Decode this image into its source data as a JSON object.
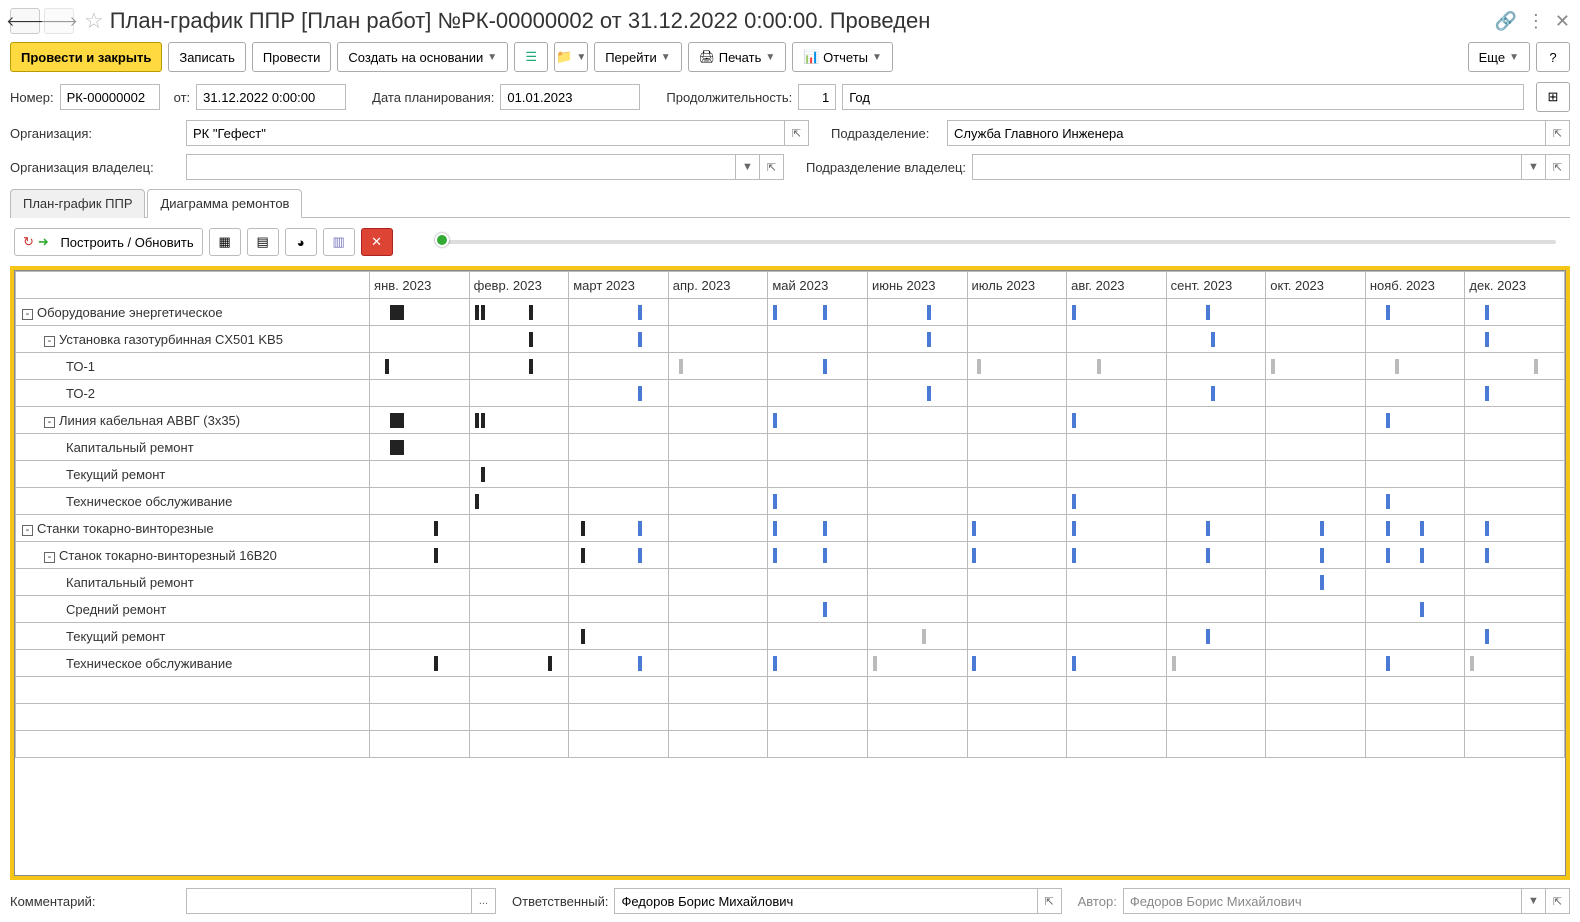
{
  "header": {
    "title": "План-график ППР [План работ] №РК-00000002 от 31.12.2022 0:00:00. Проведен"
  },
  "toolbar": {
    "post_close": "Провести и закрыть",
    "save": "Записать",
    "post": "Провести",
    "create_based": "Создать на основании",
    "goto": "Перейти",
    "print": "Печать",
    "reports": "Отчеты",
    "more": "Еще"
  },
  "form": {
    "number_lbl": "Номер:",
    "number_val": "РК-00000002",
    "from_lbl": "от:",
    "date_val": "31.12.2022 0:00:00",
    "plan_date_lbl": "Дата планирования:",
    "plan_date_val": "01.01.2023",
    "duration_lbl": "Продолжительность:",
    "duration_val": "1",
    "duration_unit": "Год",
    "org_lbl": "Организация:",
    "org_val": "РК \"Гефест\"",
    "dept_lbl": "Подразделение:",
    "dept_val": "Служба Главного Инженера",
    "org_owner_lbl": "Организация владелец:",
    "org_owner_val": "",
    "dept_owner_lbl": "Подразделение владелец:",
    "dept_owner_val": ""
  },
  "tabs": {
    "tab1": "План-график ППР",
    "tab2": "Диаграмма ремонтов"
  },
  "subtoolbar": {
    "rebuild": "Построить / Обновить"
  },
  "gantt": {
    "months": [
      "янв. 2023",
      "февр. 2023",
      "март 2023",
      "апр. 2023",
      "май 2023",
      "июнь 2023",
      "июль 2023",
      "авг. 2023",
      "сент. 2023",
      "окт. 2023",
      "нояб. 2023",
      "дек. 2023"
    ],
    "rows": [
      {
        "name": "Оборудование энергетическое",
        "indent": 0,
        "toggle": true,
        "bars": [
          {
            "m": 0,
            "cls": "black wide",
            "l": 20
          },
          {
            "m": 1,
            "cls": "black thin",
            "l": 5
          },
          {
            "m": 1,
            "cls": "black thin",
            "l": 12
          },
          {
            "m": 1,
            "cls": "black thin",
            "l": 60
          },
          {
            "m": 2,
            "cls": "blue thin",
            "l": 70
          },
          {
            "m": 4,
            "cls": "blue thin",
            "l": 5
          },
          {
            "m": 4,
            "cls": "blue thin",
            "l": 55
          },
          {
            "m": 5,
            "cls": "blue thin",
            "l": 60
          },
          {
            "m": 7,
            "cls": "blue thin",
            "l": 5
          },
          {
            "m": 8,
            "cls": "blue thin",
            "l": 40
          },
          {
            "m": 10,
            "cls": "blue thin",
            "l": 20
          },
          {
            "m": 11,
            "cls": "blue thin",
            "l": 20
          }
        ]
      },
      {
        "name": "Установка газотурбинная CX501 KB5",
        "indent": 1,
        "toggle": true,
        "bars": [
          {
            "m": 1,
            "cls": "black thin",
            "l": 60
          },
          {
            "m": 2,
            "cls": "blue thin",
            "l": 70
          },
          {
            "m": 5,
            "cls": "blue thin",
            "l": 60
          },
          {
            "m": 8,
            "cls": "blue thin",
            "l": 45
          },
          {
            "m": 11,
            "cls": "blue thin",
            "l": 20
          }
        ]
      },
      {
        "name": "ТО-1",
        "indent": 2,
        "bars": [
          {
            "m": 0,
            "cls": "black thin",
            "l": 15
          },
          {
            "m": 1,
            "cls": "black thin",
            "l": 60
          },
          {
            "m": 3,
            "cls": "gray thin",
            "l": 10
          },
          {
            "m": 4,
            "cls": "blue thin",
            "l": 55
          },
          {
            "m": 6,
            "cls": "gray thin",
            "l": 10
          },
          {
            "m": 7,
            "cls": "gray thin",
            "l": 30
          },
          {
            "m": 9,
            "cls": "gray thin",
            "l": 5
          },
          {
            "m": 10,
            "cls": "gray thin",
            "l": 30
          },
          {
            "m": 11,
            "cls": "gray thin",
            "l": 70
          }
        ]
      },
      {
        "name": "ТО-2",
        "indent": 2,
        "bars": [
          {
            "m": 2,
            "cls": "blue thin",
            "l": 70
          },
          {
            "m": 5,
            "cls": "blue thin",
            "l": 60
          },
          {
            "m": 8,
            "cls": "blue thin",
            "l": 45
          },
          {
            "m": 11,
            "cls": "blue thin",
            "l": 20
          }
        ]
      },
      {
        "name": "Линия кабельная АВВГ (3x35)",
        "indent": 1,
        "toggle": true,
        "bars": [
          {
            "m": 0,
            "cls": "black wide",
            "l": 20
          },
          {
            "m": 1,
            "cls": "black thin",
            "l": 5
          },
          {
            "m": 1,
            "cls": "black thin",
            "l": 12
          },
          {
            "m": 4,
            "cls": "blue thin",
            "l": 5
          },
          {
            "m": 7,
            "cls": "blue thin",
            "l": 5
          },
          {
            "m": 10,
            "cls": "blue thin",
            "l": 20
          }
        ]
      },
      {
        "name": "Капитальный ремонт",
        "indent": 2,
        "bars": [
          {
            "m": 0,
            "cls": "black wide",
            "l": 20
          }
        ]
      },
      {
        "name": "Текущий ремонт",
        "indent": 2,
        "bars": [
          {
            "m": 1,
            "cls": "black thin",
            "l": 12
          }
        ]
      },
      {
        "name": "Техническое обслуживание",
        "indent": 2,
        "bars": [
          {
            "m": 1,
            "cls": "black thin",
            "l": 5
          },
          {
            "m": 4,
            "cls": "blue thin",
            "l": 5
          },
          {
            "m": 7,
            "cls": "blue thin",
            "l": 5
          },
          {
            "m": 10,
            "cls": "blue thin",
            "l": 20
          }
        ]
      },
      {
        "name": "Станки токарно-винторезные",
        "indent": 0,
        "toggle": true,
        "bars": [
          {
            "m": 0,
            "cls": "black thin",
            "l": 65
          },
          {
            "m": 2,
            "cls": "black thin",
            "l": 12
          },
          {
            "m": 2,
            "cls": "blue thin",
            "l": 70
          },
          {
            "m": 4,
            "cls": "blue thin",
            "l": 5
          },
          {
            "m": 4,
            "cls": "blue thin",
            "l": 55
          },
          {
            "m": 6,
            "cls": "blue thin",
            "l": 5
          },
          {
            "m": 7,
            "cls": "blue thin",
            "l": 5
          },
          {
            "m": 8,
            "cls": "blue thin",
            "l": 40
          },
          {
            "m": 9,
            "cls": "blue thin",
            "l": 55
          },
          {
            "m": 10,
            "cls": "blue thin",
            "l": 20
          },
          {
            "m": 10,
            "cls": "blue thin",
            "l": 55
          },
          {
            "m": 11,
            "cls": "blue thin",
            "l": 20
          }
        ]
      },
      {
        "name": "Станок токарно-винторезный 16В20",
        "indent": 1,
        "toggle": true,
        "bars": [
          {
            "m": 0,
            "cls": "black thin",
            "l": 65
          },
          {
            "m": 2,
            "cls": "black thin",
            "l": 12
          },
          {
            "m": 2,
            "cls": "blue thin",
            "l": 70
          },
          {
            "m": 4,
            "cls": "blue thin",
            "l": 5
          },
          {
            "m": 4,
            "cls": "blue thin",
            "l": 55
          },
          {
            "m": 6,
            "cls": "blue thin",
            "l": 5
          },
          {
            "m": 7,
            "cls": "blue thin",
            "l": 5
          },
          {
            "m": 8,
            "cls": "blue thin",
            "l": 40
          },
          {
            "m": 9,
            "cls": "blue thin",
            "l": 55
          },
          {
            "m": 10,
            "cls": "blue thin",
            "l": 20
          },
          {
            "m": 10,
            "cls": "blue thin",
            "l": 55
          },
          {
            "m": 11,
            "cls": "blue thin",
            "l": 20
          }
        ]
      },
      {
        "name": "Капитальный ремонт",
        "indent": 2,
        "bars": [
          {
            "m": 9,
            "cls": "blue thin",
            "l": 55
          }
        ]
      },
      {
        "name": "Средний ремонт",
        "indent": 2,
        "bars": [
          {
            "m": 4,
            "cls": "blue thin",
            "l": 55
          },
          {
            "m": 10,
            "cls": "blue thin",
            "l": 55
          }
        ]
      },
      {
        "name": "Текущий ремонт",
        "indent": 2,
        "bars": [
          {
            "m": 2,
            "cls": "black thin",
            "l": 12
          },
          {
            "m": 5,
            "cls": "gray thin",
            "l": 55
          },
          {
            "m": 8,
            "cls": "blue thin",
            "l": 40
          },
          {
            "m": 11,
            "cls": "blue thin",
            "l": 20
          }
        ]
      },
      {
        "name": "Техническое обслуживание",
        "indent": 2,
        "bars": [
          {
            "m": 0,
            "cls": "black thin",
            "l": 65
          },
          {
            "m": 1,
            "cls": "black thin",
            "l": 80
          },
          {
            "m": 2,
            "cls": "blue thin",
            "l": 70
          },
          {
            "m": 4,
            "cls": "blue thin",
            "l": 5
          },
          {
            "m": 5,
            "cls": "gray thin",
            "l": 5
          },
          {
            "m": 6,
            "cls": "blue thin",
            "l": 5
          },
          {
            "m": 7,
            "cls": "blue thin",
            "l": 5
          },
          {
            "m": 8,
            "cls": "gray thin",
            "l": 5
          },
          {
            "m": 10,
            "cls": "blue thin",
            "l": 20
          },
          {
            "m": 11,
            "cls": "gray thin",
            "l": 5
          }
        ]
      }
    ]
  },
  "footer": {
    "comment_lbl": "Комментарий:",
    "comment_val": "",
    "responsible_lbl": "Ответственный:",
    "responsible_val": "Федоров Борис Михайлович",
    "author_lbl": "Автор:",
    "author_val": "Федоров Борис Михайлович"
  }
}
